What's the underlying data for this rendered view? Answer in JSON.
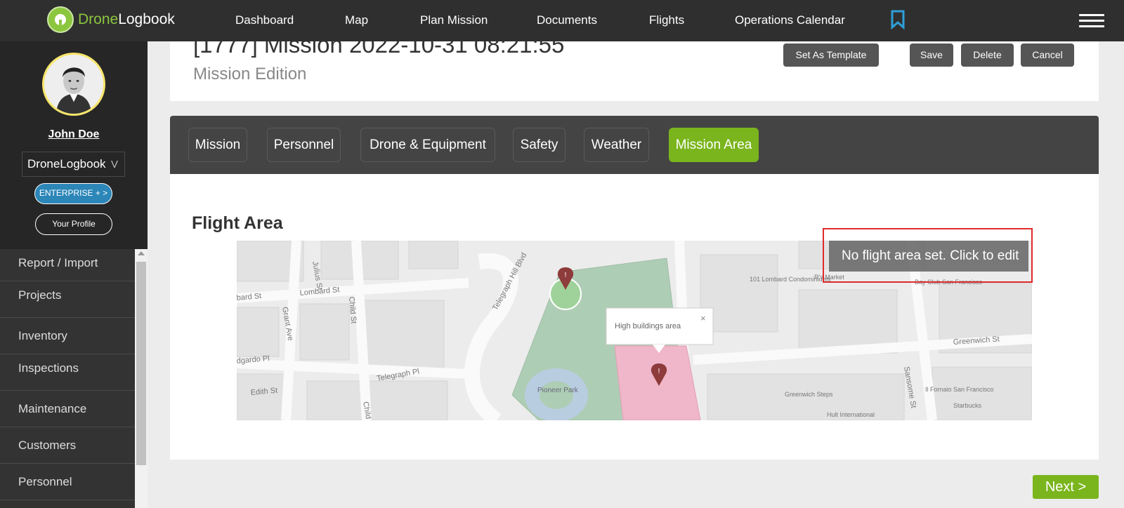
{
  "brand": {
    "prefix": "Drone",
    "suffix": "Logbook"
  },
  "nav": {
    "links": [
      "Dashboard",
      "Map",
      "Plan Mission",
      "Documents",
      "Flights",
      "Operations Calendar"
    ],
    "bookmark_icon": "bookmark-icon",
    "menu_icon": "hamburger-menu-icon"
  },
  "user": {
    "name": "John Doe",
    "organization": "DroneLogbook",
    "org_chevron": "V",
    "enterprise_label": "ENTERPRISE + >",
    "profile_label": "Your Profile"
  },
  "sidebar": {
    "items": [
      "Report / Import",
      "Projects",
      "Inventory",
      "Inspections",
      "Maintenance",
      "Customers",
      "Personnel"
    ]
  },
  "header": {
    "title": "[1777] Mission 2022-10-31 08:21:55",
    "subtitle": "Mission Edition",
    "buttons": {
      "template": "Set As Template",
      "save": "Save",
      "delete": "Delete",
      "cancel": "Cancel"
    }
  },
  "tabs": {
    "items": [
      "Mission",
      "Personnel",
      "Drone & Equipment",
      "Safety",
      "Weather",
      "Mission Area"
    ],
    "active": "Mission Area"
  },
  "flight_area": {
    "title": "Flight Area",
    "overlay_text": "No flight area set. Click to  edit",
    "popup_text": "High buildings area",
    "popup_close": "×",
    "streets": [
      "Lombard St",
      "Julius St",
      "Grant Ave",
      "Child St",
      "Telegraph Hill Blvd",
      "Telegraph Pl",
      "Edith St",
      "Sansome St",
      "Greenwich St",
      "Child St",
      "bard St",
      "dgardo Pl"
    ],
    "places": [
      "Pioneer Park",
      "101 Lombard Condominiums",
      "Greenwich Steps",
      "Il Fornaio San Francisco",
      "Starbucks",
      "Bay Club San Francisco",
      "R's Market",
      "Hult International"
    ]
  },
  "footer": {
    "next_label": "Next >"
  },
  "colors": {
    "accent": "#7ab51d",
    "nav_bg": "#2f2f2f",
    "enterprise": "#2c86b8",
    "highlight": "#e02a2a"
  }
}
